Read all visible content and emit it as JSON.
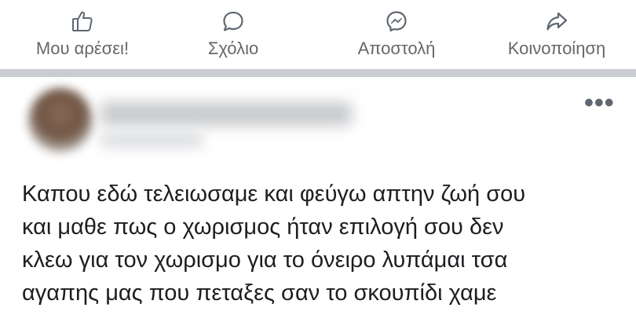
{
  "actions": [
    {
      "label": "Μου αρέσει!",
      "icon": "thumbs-up-icon"
    },
    {
      "label": "Σχόλιο",
      "icon": "comment-icon"
    },
    {
      "label": "Αποστολή",
      "icon": "messenger-icon"
    },
    {
      "label": "Κοινοποίηση",
      "icon": "share-icon"
    }
  ],
  "post": {
    "more_label": "•••",
    "text": "Καπου εδώ τελειωσαμε και φεύγω απτην ζωή σου\nκαι μαθε πως ο χωρισμος ήταν επιλογή σου δεν\nκλεω για τον χωρισμο για το όνειρο λυπάμαι τσα\nαγαπης μας που πεταξες σαν το σκουπίδι χαμε"
  },
  "colors": {
    "icon_gray": "#606770",
    "label_gray": "#65676b",
    "divider": "#c9ccd1",
    "text": "#1c1e21"
  }
}
